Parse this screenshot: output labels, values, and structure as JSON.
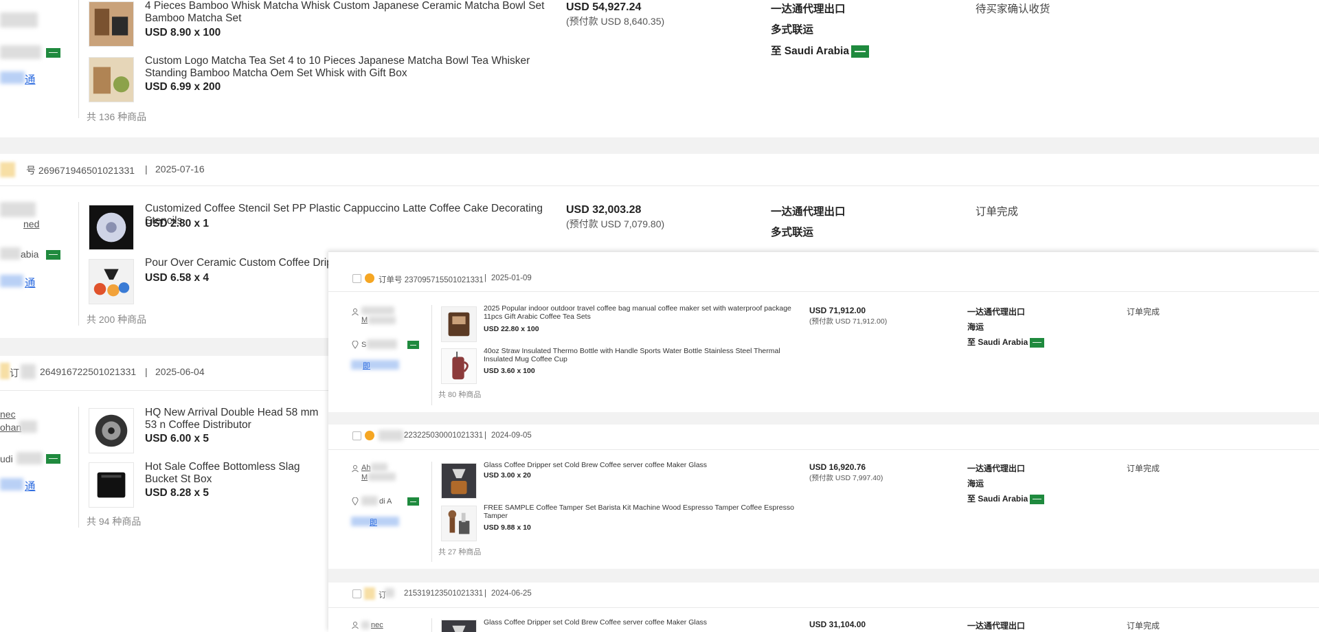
{
  "back": {
    "order1": {
      "items": [
        {
          "title": "4 Pieces Bamboo Whisk Matcha Whisk Custom Japanese Ceramic Matcha Bowl Set Bamboo Matcha Set",
          "price": "USD 8.90 x 100"
        },
        {
          "title": "Custom Logo Matcha Tea Set 4 to 10 Pieces Japanese Matcha Bowl Tea Whisker Standing Bamboo Matcha Oem Set Whisk with Gift Box",
          "price": "USD 6.99 x 200"
        }
      ],
      "count": "共 136 种商品",
      "total": "USD 54,927.24",
      "prepay": "(预付款 USD 8,640.35)",
      "service": "一达通代理出口",
      "shipping": "多式联运",
      "dest": "至 Saudi Arabia",
      "status": "待买家确认收货",
      "side_link": "通"
    },
    "order2": {
      "header_id": "号 269671946501021331",
      "header_date": "2025-07-16",
      "items": [
        {
          "title": "Customized Coffee Stencil Set PP Plastic Cappuccino Latte Coffee Cake Decorating Stencils",
          "price": "USD 2.80 x 1"
        },
        {
          "title": "Pour Over Ceramic Custom Coffee Dripper",
          "price": "USD 6.58 x 4"
        }
      ],
      "count": "共 200 种商品",
      "total": "USD 32,003.28",
      "prepay": "(预付款 USD 7,079.80)",
      "service": "一达通代理出口",
      "shipping": "多式联运",
      "status": "订单完成",
      "side_name": "ned",
      "side_country": "abia",
      "side_link": "通"
    },
    "order3": {
      "header_prefix": "订",
      "header_id": "264916722501021331",
      "header_date": "2025-06-04",
      "items": [
        {
          "title": "HQ New Arrival Double Head 58 mm 53 n Coffee Distributor",
          "price": "USD 6.00 x 5"
        },
        {
          "title": "Hot Sale Coffee Bottomless Slag Bucket St Box",
          "price": "USD 8.28 x 5"
        }
      ],
      "count": "共 94 种商品",
      "side_name1": "nec",
      "side_name2": "ohan",
      "side_country": "udi",
      "side_link": "通"
    }
  },
  "front": {
    "order_a": {
      "header_label": "订单号 237095715501021331",
      "header_date": "2025-01-09",
      "items": [
        {
          "title": "2025 Popular indoor outdoor travel coffee bag manual coffee maker set with waterproof package 11pcs Gift Arabic Coffee Tea Sets",
          "price": "USD 22.80 x 100"
        },
        {
          "title": "40oz Straw Insulated Thermo Bottle with Handle Sports Water Bottle Stainless Steel Thermal Insulated Mug Coffee Cup",
          "price": "USD 3.60 x 100"
        }
      ],
      "count": "共 80 种商品",
      "total": "USD 71,912.00",
      "prepay": "(预付款 USD 71,912.00)",
      "service": "一达通代理出口",
      "shipping": "海运",
      "dest": "至 Saudi Arabia",
      "status": "订单完成",
      "side_name": "M",
      "side_country": "S",
      "side_link": "即"
    },
    "order_b": {
      "header_id": "223225030001021331",
      "header_date": "2024-09-05",
      "items": [
        {
          "title": "Glass Coffee Dripper set Cold Brew Coffee server coffee Maker Glass",
          "price": "USD 3.00 x 20"
        },
        {
          "title": "FREE SAMPLE Coffee Tamper Set Barista Kit Machine Wood Espresso Tamper Coffee Espresso Tamper",
          "price": "USD 9.88 x 10"
        }
      ],
      "count": "共 27 种商品",
      "total": "USD 16,920.76",
      "prepay": "(预付款 USD 7,997.40)",
      "service": "一达通代理出口",
      "shipping": "海运",
      "dest": "至 Saudi Arabia",
      "status": "订单完成",
      "side_name1": "Ah",
      "side_name2": "M",
      "side_country": "di A",
      "side_link": "即"
    },
    "order_c": {
      "header_prefix": "订",
      "header_id": "215319123501021331",
      "header_date": "2024-06-25",
      "items": [
        {
          "title": "Glass Coffee Dripper set Cold Brew Coffee server coffee Maker Glass"
        }
      ],
      "total": "USD 31,104.00",
      "service": "一达通代理出口",
      "status": "订单完成",
      "side_name": "nec"
    }
  }
}
